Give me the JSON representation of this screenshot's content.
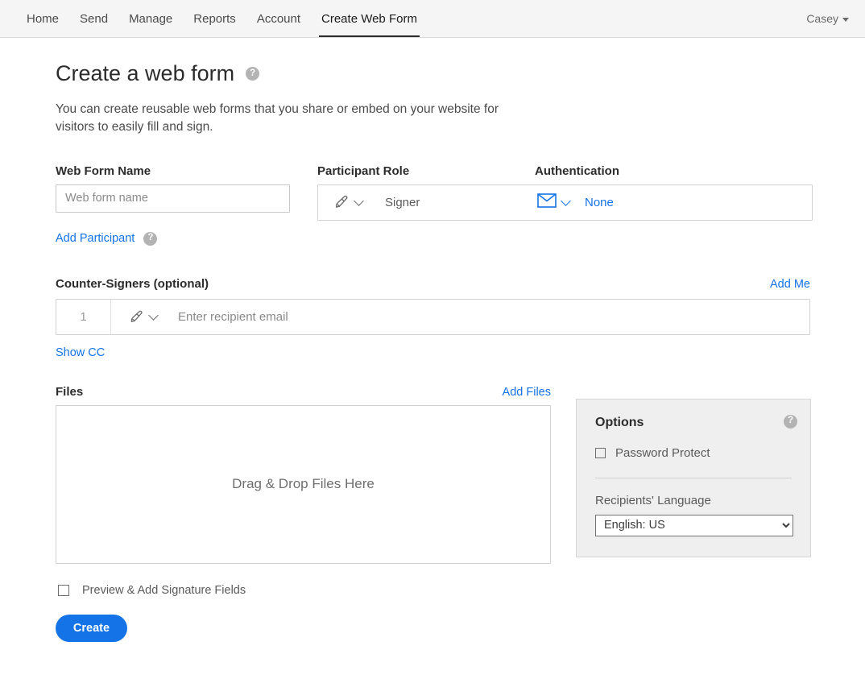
{
  "topnav": {
    "items": [
      {
        "label": "Home",
        "active": false
      },
      {
        "label": "Send",
        "active": false
      },
      {
        "label": "Manage",
        "active": false
      },
      {
        "label": "Reports",
        "active": false
      },
      {
        "label": "Account",
        "active": false
      },
      {
        "label": "Create Web Form",
        "active": true
      }
    ],
    "user": "Casey",
    "user_caret_icon": "caret-down-icon",
    "active_underline_color": "#2c2c2c",
    "background": "#f5f5f5"
  },
  "page": {
    "title": "Create a web form",
    "title_help_icon": "help-circle-icon",
    "help_glyph": "?",
    "description": "You can create reusable web forms that you share or embed on your website for visitors to easily fill and sign."
  },
  "form": {
    "web_form_name_label": "Web Form Name",
    "web_form_name_value": "",
    "web_form_name_placeholder": "Web form name",
    "participant_role_label": "Participant Role",
    "participant_role_icon": "pen-nib-icon",
    "participant_role_chevron_icon": "chevron-down-icon",
    "participant_role_value": "Signer",
    "authentication_label": "Authentication",
    "authentication_icon": "envelope-icon",
    "authentication_chevron_icon": "chevron-down-icon",
    "authentication_value": "None",
    "add_participant_label": "Add Participant",
    "add_participant_help_icon": "help-circle-icon"
  },
  "counter_signers": {
    "heading": "Counter-Signers (optional)",
    "add_me_label": "Add Me",
    "rows": [
      {
        "number": "1",
        "role_icon": "pen-nib-icon",
        "role_chevron_icon": "chevron-down-icon",
        "email_value": "",
        "email_placeholder": "Enter recipient email"
      }
    ],
    "show_cc_label": "Show CC"
  },
  "files": {
    "heading": "Files",
    "add_files_label": "Add Files",
    "dropzone_text": "Drag & Drop Files Here"
  },
  "options": {
    "title": "Options",
    "help_icon": "help-circle-icon",
    "password_protect_label": "Password Protect",
    "password_protect_checked": false,
    "recipients_language_label": "Recipients' Language",
    "recipients_language_value": "English: US",
    "recipients_language_options": [
      "English: US"
    ]
  },
  "footer": {
    "preview_label": "Preview & Add Signature Fields",
    "preview_checked": false,
    "create_label": "Create"
  },
  "colors": {
    "accent_blue": "#1473e6",
    "nav_bg": "#f5f5f5",
    "panel_bg": "#efefef",
    "border": "#d2d2d2",
    "text": "#2c2c2c",
    "muted_text": "#5a5a5a",
    "placeholder": "#8a8a8a"
  }
}
